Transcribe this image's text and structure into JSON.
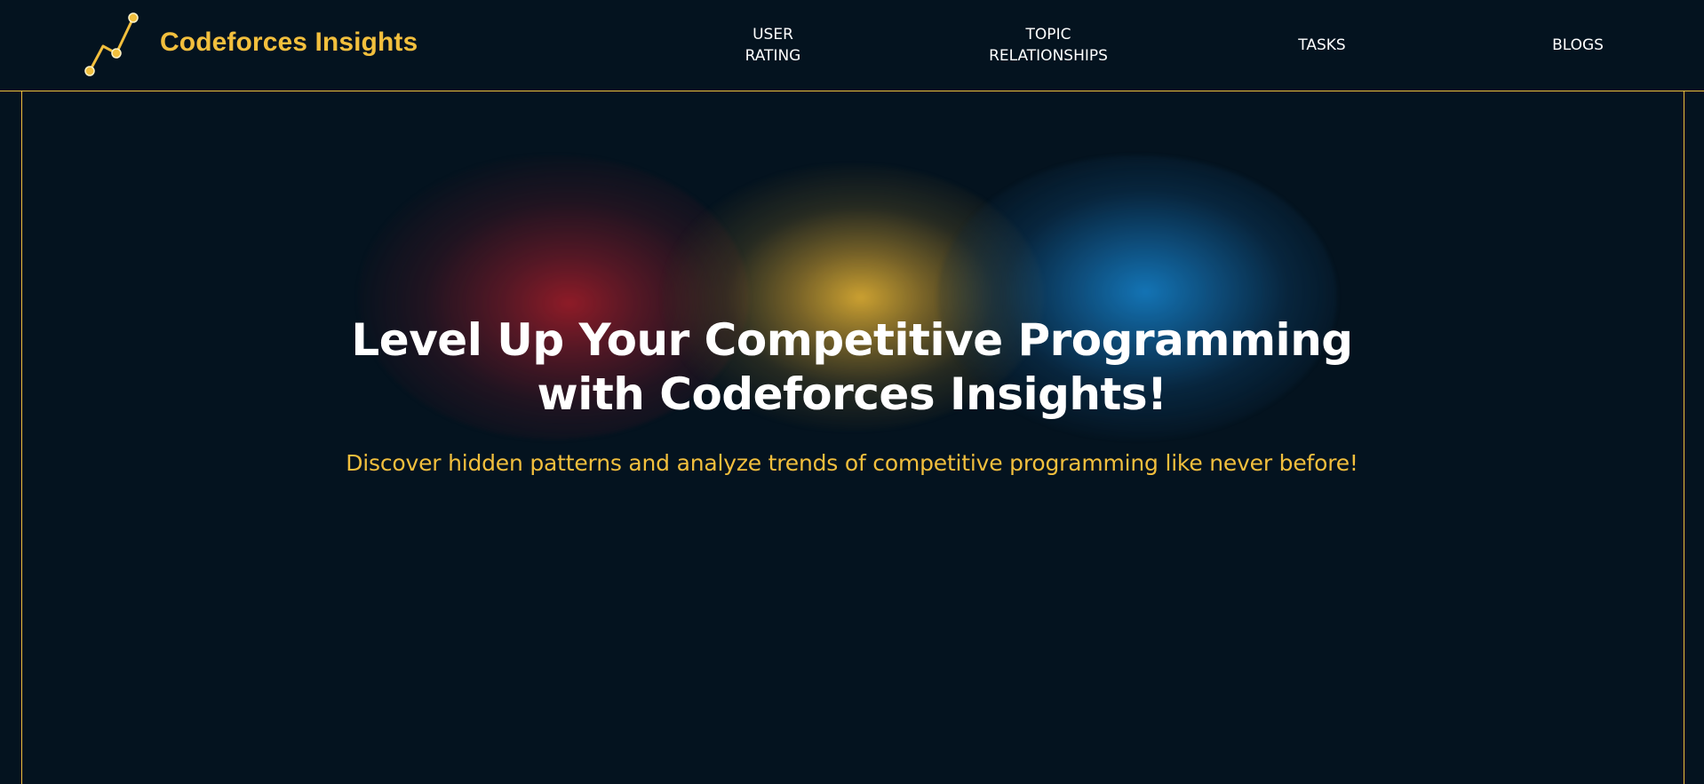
{
  "brand": {
    "name": "Codeforces Insights",
    "logo_icon": "line-chart-icon",
    "accent_color": "#f2bf3d"
  },
  "nav": {
    "items": [
      {
        "line1": "USER",
        "line2": "RATING"
      },
      {
        "line1": "TOPIC",
        "line2": "RELATIONSHIPS"
      },
      {
        "line1": "TASKS",
        "line2": ""
      },
      {
        "line1": "BLOGS",
        "line2": ""
      }
    ]
  },
  "hero": {
    "title_line1": "Level Up Your Competitive Programming",
    "title_line2": "with Codeforces Insights!",
    "subtitle": "Discover hidden patterns and analyze trends of competitive programming like never before!",
    "blob_colors": [
      "#961c28",
      "#d6a832",
      "#1476b8"
    ]
  },
  "theme": {
    "background": "#04131f",
    "border_color": "#f0be3c"
  }
}
